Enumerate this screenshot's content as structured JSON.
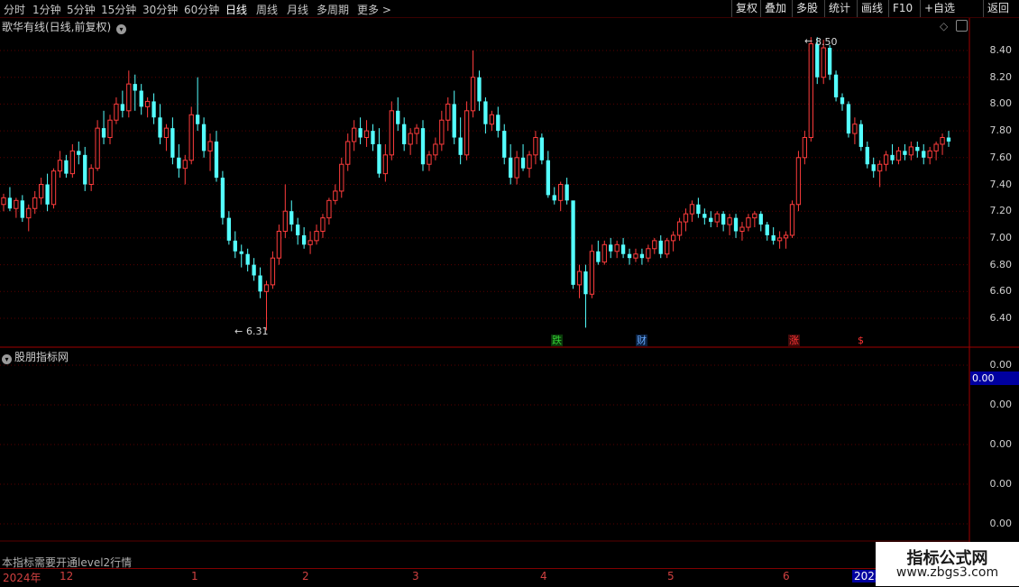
{
  "toolbar": {
    "periods": [
      "分时",
      "1分钟",
      "5分钟",
      "15分钟",
      "30分钟",
      "60分钟",
      "日线",
      "周线",
      "月线",
      "多周期",
      "更多 >"
    ],
    "active_period": "日线",
    "buttons": [
      "复权",
      "叠加",
      "多股",
      "统计",
      "画线",
      "F10",
      "+自选",
      "返回"
    ]
  },
  "main_panel": {
    "title": "歌华有线(日线,前复权)",
    "y_ticks": [
      "8.40",
      "8.20",
      "8.00",
      "7.80",
      "7.60",
      "7.40",
      "7.20",
      "7.00",
      "6.80",
      "6.60",
      "6.40"
    ],
    "high_label": "8.50",
    "low_label": "6.31",
    "markers": [
      {
        "text": "跌",
        "color": "#33cc33"
      },
      {
        "text": "财",
        "color": "#66aaff"
      },
      {
        "text": "涨",
        "color": "#ff3333"
      },
      {
        "text": "$",
        "color": "#ff3333"
      }
    ]
  },
  "sub_panel": {
    "title": "股朋指标网",
    "y_ticks": [
      "0.00",
      "0.00",
      "0.00",
      "0.00",
      "0.00"
    ],
    "current_value": "0.00",
    "note": "本指标需要开通level2行情"
  },
  "date_axis": {
    "labels": [
      "2024年",
      "12",
      "1",
      "2",
      "3",
      "4",
      "5",
      "6",
      "2025"
    ]
  },
  "watermark": {
    "line1": "指标公式网",
    "line2": "www.zbgs3.com"
  },
  "colors": {
    "up": "#ff3c3c",
    "down": "#54ffff",
    "grid": "#5a0000",
    "frame": "#a00000"
  },
  "chart_data": {
    "type": "candlestick",
    "ylim": [
      6.3,
      8.55
    ],
    "candles": [
      [
        7.25,
        7.33,
        7.2,
        7.3
      ],
      [
        7.3,
        7.38,
        7.2,
        7.22
      ],
      [
        7.22,
        7.3,
        7.15,
        7.28
      ],
      [
        7.28,
        7.32,
        7.12,
        7.15
      ],
      [
        7.15,
        7.25,
        7.05,
        7.22
      ],
      [
        7.22,
        7.35,
        7.18,
        7.3
      ],
      [
        7.3,
        7.45,
        7.25,
        7.4
      ],
      [
        7.4,
        7.48,
        7.2,
        7.25
      ],
      [
        7.25,
        7.52,
        7.22,
        7.5
      ],
      [
        7.5,
        7.65,
        7.45,
        7.58
      ],
      [
        7.58,
        7.62,
        7.45,
        7.48
      ],
      [
        7.48,
        7.7,
        7.45,
        7.65
      ],
      [
        7.65,
        7.72,
        7.55,
        7.62
      ],
      [
        7.62,
        7.68,
        7.35,
        7.4
      ],
      [
        7.4,
        7.55,
        7.35,
        7.52
      ],
      [
        7.52,
        7.88,
        7.5,
        7.82
      ],
      [
        7.82,
        7.95,
        7.7,
        7.75
      ],
      [
        7.75,
        7.92,
        7.7,
        7.88
      ],
      [
        7.88,
        8.05,
        7.85,
        8.0
      ],
      [
        8.0,
        8.1,
        7.9,
        7.95
      ],
      [
        7.95,
        8.25,
        7.9,
        8.15
      ],
      [
        8.15,
        8.22,
        7.95,
        8.1
      ],
      [
        8.1,
        8.15,
        7.92,
        7.98
      ],
      [
        7.98,
        8.05,
        7.9,
        8.02
      ],
      [
        8.02,
        8.08,
        7.85,
        7.9
      ],
      [
        7.9,
        8.0,
        7.7,
        7.75
      ],
      [
        7.75,
        7.85,
        7.65,
        7.82
      ],
      [
        7.82,
        7.9,
        7.55,
        7.6
      ],
      [
        7.6,
        7.7,
        7.45,
        7.52
      ],
      [
        7.52,
        7.62,
        7.4,
        7.58
      ],
      [
        7.58,
        7.98,
        7.55,
        7.92
      ],
      [
        7.92,
        8.2,
        7.8,
        7.85
      ],
      [
        7.85,
        7.9,
        7.6,
        7.65
      ],
      [
        7.65,
        7.78,
        7.5,
        7.72
      ],
      [
        7.72,
        7.8,
        7.42,
        7.45
      ],
      [
        7.45,
        7.5,
        7.1,
        7.15
      ],
      [
        7.15,
        7.2,
        6.95,
        6.98
      ],
      [
        6.98,
        7.05,
        6.85,
        6.9
      ],
      [
        6.9,
        6.95,
        6.78,
        6.88
      ],
      [
        6.88,
        6.92,
        6.75,
        6.8
      ],
      [
        6.8,
        6.85,
        6.68,
        6.72
      ],
      [
        6.72,
        6.78,
        6.55,
        6.6
      ],
      [
        6.6,
        6.68,
        6.31,
        6.65
      ],
      [
        6.65,
        6.9,
        6.62,
        6.85
      ],
      [
        6.85,
        7.1,
        6.8,
        7.05
      ],
      [
        7.05,
        7.4,
        7.0,
        7.2
      ],
      [
        7.2,
        7.28,
        7.05,
        7.1
      ],
      [
        7.1,
        7.15,
        6.95,
        7.02
      ],
      [
        7.02,
        7.08,
        6.92,
        6.95
      ],
      [
        6.95,
        7.05,
        6.88,
        6.98
      ],
      [
        6.98,
        7.1,
        6.95,
        7.05
      ],
      [
        7.05,
        7.18,
        7.0,
        7.15
      ],
      [
        7.15,
        7.3,
        7.1,
        7.28
      ],
      [
        7.28,
        7.4,
        7.25,
        7.35
      ],
      [
        7.35,
        7.6,
        7.3,
        7.55
      ],
      [
        7.55,
        7.78,
        7.5,
        7.72
      ],
      [
        7.72,
        7.88,
        7.65,
        7.82
      ],
      [
        7.82,
        7.9,
        7.7,
        7.75
      ],
      [
        7.75,
        7.88,
        7.68,
        7.8
      ],
      [
        7.8,
        7.85,
        7.65,
        7.7
      ],
      [
        7.7,
        7.82,
        7.45,
        7.48
      ],
      [
        7.48,
        7.7,
        7.42,
        7.62
      ],
      [
        7.62,
        8.02,
        7.58,
        7.95
      ],
      [
        7.95,
        8.05,
        7.8,
        7.85
      ],
      [
        7.85,
        7.9,
        7.65,
        7.7
      ],
      [
        7.7,
        7.82,
        7.62,
        7.78
      ],
      [
        7.78,
        7.85,
        7.7,
        7.82
      ],
      [
        7.82,
        7.88,
        7.5,
        7.55
      ],
      [
        7.55,
        7.65,
        7.5,
        7.62
      ],
      [
        7.62,
        7.75,
        7.58,
        7.7
      ],
      [
        7.7,
        7.95,
        7.65,
        7.88
      ],
      [
        7.88,
        8.05,
        7.8,
        8.0
      ],
      [
        8.0,
        8.1,
        7.7,
        7.75
      ],
      [
        7.75,
        7.9,
        7.55,
        7.62
      ],
      [
        7.62,
        8.02,
        7.58,
        7.95
      ],
      [
        7.95,
        8.4,
        7.9,
        8.2
      ],
      [
        8.2,
        8.25,
        7.95,
        8.02
      ],
      [
        8.02,
        8.05,
        7.78,
        7.85
      ],
      [
        7.85,
        7.95,
        7.8,
        7.92
      ],
      [
        7.92,
        7.98,
        7.75,
        7.8
      ],
      [
        7.8,
        7.85,
        7.55,
        7.6
      ],
      [
        7.6,
        7.7,
        7.4,
        7.45
      ],
      [
        7.45,
        7.65,
        7.4,
        7.6
      ],
      [
        7.6,
        7.7,
        7.5,
        7.52
      ],
      [
        7.52,
        7.65,
        7.45,
        7.62
      ],
      [
        7.62,
        7.8,
        7.55,
        7.75
      ],
      [
        7.75,
        7.78,
        7.55,
        7.58
      ],
      [
        7.58,
        7.65,
        7.3,
        7.32
      ],
      [
        7.32,
        7.38,
        7.25,
        7.28
      ],
      [
        7.28,
        7.42,
        7.2,
        7.4
      ],
      [
        7.4,
        7.45,
        7.25,
        7.28
      ],
      [
        7.28,
        7.05,
        6.62,
        6.65
      ],
      [
        6.65,
        6.8,
        6.55,
        6.75
      ],
      [
        6.75,
        6.8,
        6.33,
        6.58
      ],
      [
        6.58,
        6.95,
        6.55,
        6.9
      ],
      [
        6.9,
        6.98,
        6.8,
        6.82
      ],
      [
        6.82,
        6.98,
        6.8,
        6.95
      ],
      [
        6.95,
        7.0,
        6.85,
        6.9
      ],
      [
        6.9,
        6.98,
        6.85,
        6.95
      ],
      [
        6.95,
        7.0,
        6.85,
        6.88
      ],
      [
        6.88,
        6.92,
        6.8,
        6.85
      ],
      [
        6.85,
        6.92,
        6.82,
        6.88
      ],
      [
        6.88,
        6.92,
        6.8,
        6.85
      ],
      [
        6.85,
        6.95,
        6.82,
        6.92
      ],
      [
        6.92,
        7.0,
        6.88,
        6.98
      ],
      [
        6.98,
        7.02,
        6.85,
        6.88
      ],
      [
        6.88,
        7.0,
        6.85,
        6.98
      ],
      [
        6.98,
        7.05,
        6.9,
        7.02
      ],
      [
        7.02,
        7.15,
        6.98,
        7.12
      ],
      [
        7.12,
        7.22,
        7.05,
        7.18
      ],
      [
        7.18,
        7.28,
        7.12,
        7.25
      ],
      [
        7.25,
        7.3,
        7.15,
        7.18
      ],
      [
        7.18,
        7.22,
        7.1,
        7.15
      ],
      [
        7.15,
        7.2,
        7.08,
        7.12
      ],
      [
        7.12,
        7.2,
        7.08,
        7.18
      ],
      [
        7.18,
        7.2,
        7.05,
        7.1
      ],
      [
        7.1,
        7.18,
        7.02,
        7.15
      ],
      [
        7.15,
        7.18,
        7.0,
        7.05
      ],
      [
        7.05,
        7.12,
        6.98,
        7.08
      ],
      [
        7.08,
        7.18,
        7.05,
        7.15
      ],
      [
        7.15,
        7.2,
        7.08,
        7.18
      ],
      [
        7.18,
        7.2,
        7.05,
        7.1
      ],
      [
        7.1,
        7.12,
        6.98,
        7.02
      ],
      [
        7.02,
        7.08,
        6.95,
        6.98
      ],
      [
        6.98,
        7.05,
        6.92,
        7.0
      ],
      [
        7.0,
        7.05,
        6.92,
        7.02
      ],
      [
        7.02,
        7.28,
        7.0,
        7.25
      ],
      [
        7.25,
        7.65,
        7.2,
        7.6
      ],
      [
        7.6,
        7.8,
        7.55,
        7.75
      ],
      [
        7.75,
        8.5,
        7.72,
        8.45
      ],
      [
        8.45,
        8.5,
        8.15,
        8.2
      ],
      [
        8.2,
        8.48,
        8.15,
        8.42
      ],
      [
        8.42,
        8.44,
        8.18,
        8.22
      ],
      [
        8.22,
        8.25,
        8.02,
        8.05
      ],
      [
        8.05,
        8.08,
        7.95,
        8.0
      ],
      [
        8.0,
        8.02,
        7.75,
        7.78
      ],
      [
        7.78,
        7.9,
        7.7,
        7.85
      ],
      [
        7.85,
        7.88,
        7.65,
        7.68
      ],
      [
        7.68,
        7.72,
        7.52,
        7.55
      ],
      [
        7.55,
        7.6,
        7.45,
        7.5
      ],
      [
        7.5,
        7.58,
        7.38,
        7.55
      ],
      [
        7.55,
        7.65,
        7.5,
        7.62
      ],
      [
        7.62,
        7.7,
        7.55,
        7.58
      ],
      [
        7.58,
        7.68,
        7.55,
        7.65
      ],
      [
        7.65,
        7.7,
        7.58,
        7.62
      ],
      [
        7.62,
        7.72,
        7.58,
        7.68
      ],
      [
        7.68,
        7.72,
        7.6,
        7.65
      ],
      [
        7.65,
        7.7,
        7.55,
        7.6
      ],
      [
        7.6,
        7.68,
        7.55,
        7.65
      ],
      [
        7.65,
        7.72,
        7.58,
        7.7
      ],
      [
        7.7,
        7.78,
        7.62,
        7.75
      ],
      [
        7.75,
        7.8,
        7.68,
        7.72
      ]
    ]
  }
}
